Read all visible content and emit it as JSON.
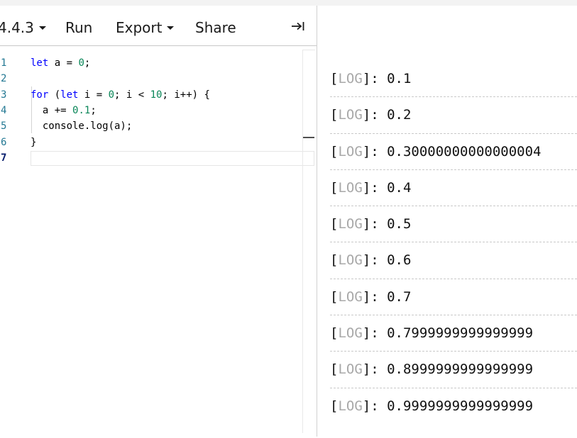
{
  "toolbar": {
    "version_label": "4.4.3",
    "run_label": "Run",
    "export_label": "Export",
    "share_label": "Share",
    "collapse_icon": "→|"
  },
  "editor": {
    "lines": [
      {
        "number": "1",
        "parts": [
          {
            "t": "let",
            "c": "kw"
          },
          {
            "t": " a = ",
            "c": ""
          },
          {
            "t": "0",
            "c": "num"
          },
          {
            "t": ";",
            "c": ""
          }
        ]
      },
      {
        "number": "2",
        "parts": []
      },
      {
        "number": "3",
        "parts": [
          {
            "t": "for",
            "c": "kw"
          },
          {
            "t": " (",
            "c": ""
          },
          {
            "t": "let",
            "c": "kw"
          },
          {
            "t": " i = ",
            "c": ""
          },
          {
            "t": "0",
            "c": "num"
          },
          {
            "t": "; i < ",
            "c": ""
          },
          {
            "t": "10",
            "c": "num"
          },
          {
            "t": "; i++) {",
            "c": ""
          }
        ]
      },
      {
        "number": "4",
        "parts": [
          {
            "t": "  a += ",
            "c": ""
          },
          {
            "t": "0.1",
            "c": "num"
          },
          {
            "t": ";",
            "c": ""
          }
        ]
      },
      {
        "number": "5",
        "parts": [
          {
            "t": "  console.log(a);",
            "c": ""
          }
        ]
      },
      {
        "number": "6",
        "parts": [
          {
            "t": "}",
            "c": ""
          }
        ]
      },
      {
        "number": "7",
        "parts": [],
        "active": true
      }
    ]
  },
  "console": {
    "level_label": "LOG",
    "entries": [
      "0.1",
      "0.2",
      "0.30000000000000004",
      "0.4",
      "0.5",
      "0.6",
      "0.7",
      "0.7999999999999999",
      "0.8999999999999999",
      "0.9999999999999999"
    ]
  }
}
